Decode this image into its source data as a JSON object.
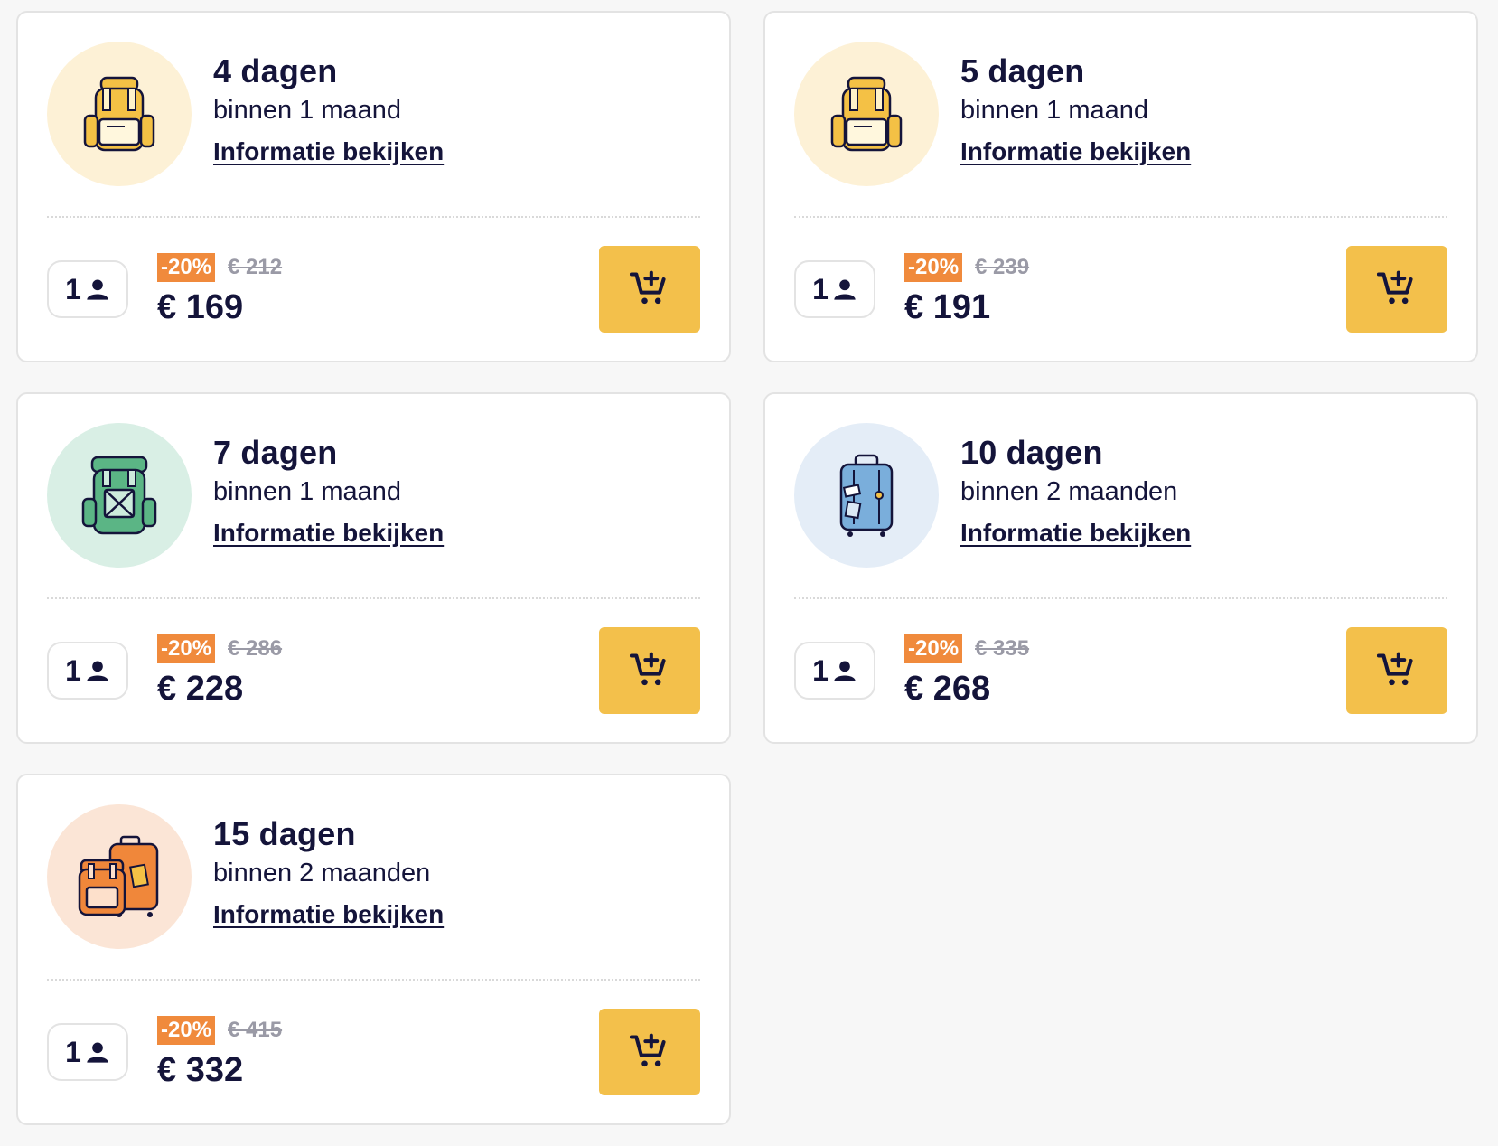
{
  "cards": [
    {
      "title": "4 dagen",
      "subtitle": "binnen 1 maand",
      "link": "Informatie bekijken",
      "pax": "1",
      "discount": "-20%",
      "old_price": "€ 212",
      "new_price": "€ 169",
      "icon": "yellow-backpack-icon",
      "circle_color": "#fdf1d6"
    },
    {
      "title": "5 dagen",
      "subtitle": "binnen 1 maand",
      "link": "Informatie bekijken",
      "pax": "1",
      "discount": "-20%",
      "old_price": "€ 239",
      "new_price": "€ 191",
      "icon": "yellow-backpack-icon",
      "circle_color": "#fdf1d6"
    },
    {
      "title": "7 dagen",
      "subtitle": "binnen 1 maand",
      "link": "Informatie bekijken",
      "pax": "1",
      "discount": "-20%",
      "old_price": "€ 286",
      "new_price": "€ 228",
      "icon": "green-backpack-icon",
      "circle_color": "#d9efe5"
    },
    {
      "title": "10 dagen",
      "subtitle": "binnen 2 maanden",
      "link": "Informatie bekijken",
      "pax": "1",
      "discount": "-20%",
      "old_price": "€ 335",
      "new_price": "€ 268",
      "icon": "blue-suitcase-icon",
      "circle_color": "#e4edf7"
    },
    {
      "title": "15 dagen",
      "subtitle": "binnen 2 maanden",
      "link": "Informatie bekijken",
      "pax": "1",
      "discount": "-20%",
      "old_price": "€ 415",
      "new_price": "€ 332",
      "icon": "orange-luggage-icon",
      "circle_color": "#fbe5d6"
    }
  ],
  "colors": {
    "accent": "#f3c04b",
    "discount": "#f08a3c",
    "text": "#14143a"
  }
}
